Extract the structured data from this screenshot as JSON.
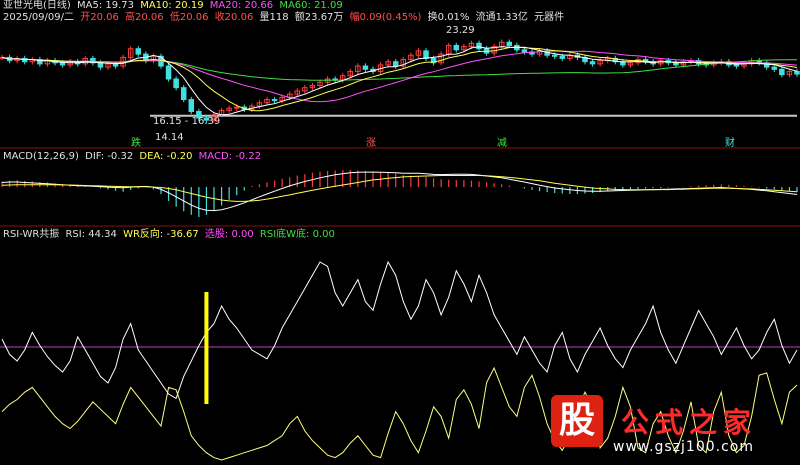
{
  "header": {
    "stock": "亚世光电(日线)",
    "ma5": "MA5: 19.73",
    "ma10": "MA10: 20.19",
    "ma20": "MA20: 20.66",
    "ma60": "MA60: 21.09"
  },
  "infobar": {
    "date": "2025/09/09/二",
    "open": "开20.06",
    "high": "高20.06",
    "low": "低20.06",
    "close": "收20.06",
    "volume": "量118",
    "amount": "额23.67万",
    "change": "幅0.09(0.45%)",
    "turnover": "换0.01%",
    "float": "流通1.33亿",
    "sector": "元器件"
  },
  "macd_header": {
    "name": "MACD(12,26,9)",
    "dif": "DIF: -0.32",
    "dea": "DEA: -0.20",
    "macd": "MACD: -0.22"
  },
  "rsi_header": {
    "name": "RSI-WR共振",
    "rsi": "RSI: 44.34",
    "wr": "WR反向: -36.67",
    "select": "选股: 0.00",
    "rsiwr": "RSI底W底: 0.00"
  },
  "annotations": {
    "high_label": "23.29",
    "low_label": "14.14",
    "range_label": "16.15 - 16.39",
    "marker_1": "跌",
    "marker_2": "涨",
    "marker_3": "减",
    "marker_4": "财"
  },
  "logo": {
    "glyph": "股",
    "brand": "公式之家",
    "url": "www.gszj100.com"
  },
  "colors": {
    "up": "#ff3c3c",
    "down": "#40e0e0",
    "ma5": "#ffffff",
    "ma10": "#ffff54",
    "ma20": "#ff50ff",
    "ma60": "#40e040",
    "rsi": "#ffffff",
    "wr": "#ffff80",
    "signal_bar": "#ffff00"
  },
  "chart_data": {
    "type": "line",
    "price": {
      "ylim": [
        13.5,
        24.5
      ],
      "close": [
        21.6,
        21.3,
        21.5,
        21.2,
        21.4,
        21.0,
        21.3,
        21.1,
        20.9,
        21.2,
        21.0,
        21.5,
        21.1,
        20.7,
        21.0,
        20.8,
        21.6,
        22.4,
        21.9,
        21.3,
        21.7,
        20.8,
        19.6,
        18.8,
        17.7,
        16.6,
        16.0,
        15.8,
        16.3,
        16.7,
        16.9,
        17.0,
        16.8,
        17.1,
        17.4,
        17.7,
        17.6,
        17.9,
        18.2,
        18.5,
        18.8,
        19.0,
        19.3,
        19.6,
        19.5,
        19.9,
        20.3,
        20.8,
        20.5,
        20.3,
        20.9,
        21.2,
        20.8,
        21.4,
        21.8,
        22.2,
        21.5,
        21.1,
        21.9,
        22.7,
        22.3,
        22.6,
        22.9,
        22.4,
        22.0,
        22.6,
        23.0,
        22.7,
        22.3,
        22.1,
        21.9,
        22.2,
        21.8,
        21.7,
        21.5,
        21.8,
        21.6,
        21.2,
        21.0,
        21.3,
        21.5,
        21.2,
        20.9,
        21.1,
        21.4,
        21.2,
        21.0,
        21.3,
        21.1,
        20.9,
        21.2,
        21.3,
        21.0,
        20.9,
        21.1,
        21.2,
        20.9,
        20.8,
        21.0,
        21.3,
        21.1,
        20.7,
        20.5,
        20.0,
        20.3,
        20.06
      ]
    },
    "macd": {
      "ylim": [
        -1.6,
        1.0
      ],
      "hist": [
        0.25,
        0.28,
        0.3,
        0.27,
        0.25,
        0.22,
        0.2,
        0.16,
        0.12,
        0.08,
        0.05,
        0.04,
        0.02,
        -0.05,
        -0.1,
        -0.16,
        -0.2,
        -0.12,
        -0.05,
        0.02,
        -0.1,
        -0.3,
        -0.6,
        -0.85,
        -1.05,
        -1.2,
        -1.3,
        -1.2,
        -1.0,
        -0.8,
        -0.55,
        -0.35,
        -0.15,
        0.05,
        0.12,
        0.2,
        0.28,
        0.36,
        0.42,
        0.5,
        0.56,
        0.62,
        0.66,
        0.7,
        0.72,
        0.74,
        0.74,
        0.72,
        0.7,
        0.68,
        0.66,
        0.62,
        0.58,
        0.52,
        0.5,
        0.48,
        0.44,
        0.38,
        0.34,
        0.32,
        0.3,
        0.3,
        0.28,
        0.24,
        0.2,
        0.16,
        0.12,
        0.06,
        0.0,
        -0.06,
        -0.12,
        -0.18,
        -0.22,
        -0.26,
        -0.28,
        -0.3,
        -0.3,
        -0.28,
        -0.26,
        -0.22,
        -0.18,
        -0.14,
        -0.12,
        -0.1,
        -0.08,
        -0.06,
        -0.05,
        -0.04,
        -0.02,
        0.0,
        0.02,
        0.04,
        0.06,
        0.08,
        0.1,
        0.12,
        0.1,
        0.08,
        0.05,
        0.02,
        -0.02,
        -0.06,
        -0.1,
        -0.14,
        -0.18,
        -0.22
      ],
      "dif": [
        0.2,
        0.22,
        0.22,
        0.2,
        0.18,
        0.16,
        0.14,
        0.12,
        0.1,
        0.08,
        0.06,
        0.05,
        0.04,
        0.02,
        0.0,
        -0.02,
        -0.03,
        0.0,
        0.02,
        0.03,
        0.0,
        -0.1,
        -0.25,
        -0.42,
        -0.6,
        -0.78,
        -0.92,
        -1.0,
        -1.02,
        -0.98,
        -0.9,
        -0.8,
        -0.68,
        -0.55,
        -0.42,
        -0.3,
        -0.18,
        -0.06,
        0.05,
        0.15,
        0.24,
        0.32,
        0.4,
        0.47,
        0.53,
        0.58,
        0.62,
        0.64,
        0.65,
        0.65,
        0.64,
        0.63,
        0.62,
        0.6,
        0.6,
        0.6,
        0.58,
        0.55,
        0.54,
        0.55,
        0.56,
        0.56,
        0.55,
        0.52,
        0.48,
        0.44,
        0.4,
        0.34,
        0.28,
        0.22,
        0.15,
        0.08,
        0.02,
        -0.04,
        -0.08,
        -0.12,
        -0.15,
        -0.17,
        -0.18,
        -0.18,
        -0.17,
        -0.16,
        -0.15,
        -0.14,
        -0.13,
        -0.12,
        -0.11,
        -0.1,
        -0.09,
        -0.08,
        -0.07,
        -0.06,
        -0.05,
        -0.04,
        -0.03,
        -0.02,
        -0.04,
        -0.06,
        -0.08,
        -0.1,
        -0.13,
        -0.16,
        -0.2,
        -0.24,
        -0.28,
        -0.32
      ],
      "dea": [
        0.08,
        0.09,
        0.1,
        0.1,
        0.1,
        0.1,
        0.1,
        0.1,
        0.09,
        0.09,
        0.08,
        0.07,
        0.06,
        0.05,
        0.04,
        0.03,
        0.02,
        0.01,
        0.01,
        0.01,
        0.0,
        -0.02,
        -0.06,
        -0.12,
        -0.2,
        -0.28,
        -0.36,
        -0.44,
        -0.5,
        -0.56,
        -0.6,
        -0.62,
        -0.62,
        -0.6,
        -0.57,
        -0.52,
        -0.46,
        -0.4,
        -0.34,
        -0.27,
        -0.2,
        -0.14,
        -0.08,
        -0.02,
        0.04,
        0.09,
        0.14,
        0.2,
        0.26,
        0.31,
        0.34,
        0.38,
        0.41,
        0.44,
        0.46,
        0.47,
        0.48,
        0.49,
        0.5,
        0.5,
        0.5,
        0.5,
        0.5,
        0.5,
        0.49,
        0.47,
        0.45,
        0.42,
        0.39,
        0.35,
        0.31,
        0.27,
        0.22,
        0.17,
        0.12,
        0.08,
        0.04,
        0.0,
        -0.04,
        -0.06,
        -0.08,
        -0.1,
        -0.11,
        -0.12,
        -0.12,
        -0.12,
        -0.12,
        -0.11,
        -0.11,
        -0.1,
        -0.09,
        -0.08,
        -0.07,
        -0.06,
        -0.05,
        -0.05,
        -0.05,
        -0.06,
        -0.07,
        -0.08,
        -0.1,
        -0.12,
        -0.14,
        -0.16,
        -0.18,
        -0.2
      ]
    },
    "rsi_wr": {
      "ylim": [
        0,
        100
      ],
      "rsi": [
        55,
        48,
        45,
        50,
        58,
        52,
        47,
        43,
        40,
        45,
        56,
        50,
        44,
        38,
        35,
        42,
        55,
        62,
        50,
        45,
        40,
        35,
        30,
        28,
        38,
        45,
        52,
        58,
        62,
        70,
        64,
        60,
        55,
        50,
        48,
        46,
        52,
        60,
        66,
        72,
        78,
        84,
        90,
        88,
        76,
        70,
        76,
        82,
        72,
        68,
        80,
        90,
        84,
        72,
        64,
        70,
        82,
        76,
        66,
        74,
        86,
        80,
        72,
        84,
        76,
        66,
        60,
        54,
        48,
        56,
        50,
        44,
        40,
        52,
        58,
        46,
        40,
        48,
        54,
        60,
        52,
        46,
        42,
        50,
        56,
        62,
        70,
        58,
        50,
        44,
        52,
        60,
        68,
        62,
        56,
        48,
        54,
        60,
        52,
        46,
        50,
        58,
        64,
        52,
        44,
        50
      ],
      "wr": [
        40,
        46,
        50,
        56,
        60,
        52,
        44,
        36,
        30,
        26,
        32,
        40,
        48,
        42,
        36,
        30,
        46,
        60,
        52,
        44,
        36,
        28,
        60,
        58,
        40,
        20,
        12,
        6,
        2,
        0,
        2,
        4,
        6,
        8,
        10,
        12,
        16,
        20,
        30,
        36,
        24,
        16,
        10,
        4,
        2,
        6,
        14,
        20,
        12,
        4,
        2,
        22,
        40,
        30,
        16,
        6,
        24,
        44,
        36,
        18,
        50,
        58,
        46,
        26,
        64,
        76,
        60,
        44,
        36,
        60,
        70,
        52,
        30,
        16,
        8,
        20,
        42,
        56,
        44,
        10,
        18,
        36,
        60,
        44,
        10,
        6,
        30,
        40,
        20,
        6,
        24,
        48,
        12,
        6,
        40,
        56,
        20,
        6,
        12,
        36,
        70,
        72,
        50,
        30,
        56,
        62
      ],
      "signal_index": 27
    }
  }
}
